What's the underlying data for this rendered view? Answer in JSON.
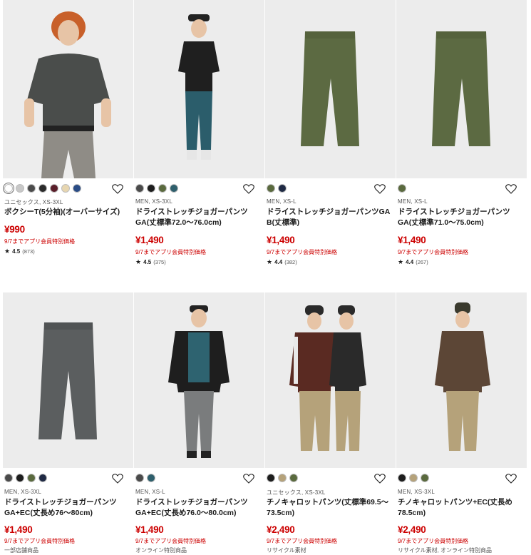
{
  "products": [
    {
      "meta": "ユニセックス, XS-3XL",
      "name": "ボクシーT(5分袖)(オーバーサイズ)",
      "price": "¥990",
      "promo": "9/7までアプリ会員特別価格",
      "rating": "4.5",
      "reviews": "(873)",
      "tag": "",
      "swatches": [
        "#ffffff",
        "#c8c8c8",
        "#4b4b4b",
        "#2a2a2a",
        "#5a1e2a",
        "#e7d6b0",
        "#2a4c86"
      ],
      "image": "model-boxy-tee"
    },
    {
      "meta": "MEN, XS-3XL",
      "name": "ドライストレッチジョガーパンツGA(丈標準72.0〜76.0cm)",
      "price": "¥1,490",
      "promo": "9/7までアプリ会員特別価格",
      "rating": "4.5",
      "reviews": "(375)",
      "tag": "",
      "swatches": [
        "#4a4a4a",
        "#1d1d1d",
        "#5a6a3e",
        "#2e5f6c"
      ],
      "image": "model-jogger-teal"
    },
    {
      "meta": "MEN, XS-L",
      "name": "ドライストレッチジョガーパンツGA B(丈標準)",
      "price": "¥1,490",
      "promo": "9/7までアプリ会員特別価格",
      "rating": "4.4",
      "reviews": "(382)",
      "tag": "",
      "swatches": [
        "#5a6a3e",
        "#1f2a44"
      ],
      "image": "olive-jogger"
    },
    {
      "meta": "MEN, XS-L",
      "name": "ドライストレッチジョガーパンツGA(丈標準71.0〜75.0cm)",
      "price": "¥1,490",
      "promo": "9/7までアプリ会員特別価格",
      "rating": "4.4",
      "reviews": "(267)",
      "tag": "",
      "swatches": [
        "#5a6a3e"
      ],
      "image": "olive-jogger-2"
    },
    {
      "meta": "MEN, XS-3XL",
      "name": "ドライストレッチジョガーパンツGA+EC(丈長め76〜80cm)",
      "price": "¥1,490",
      "promo": "9/7までアプリ会員特別価格",
      "rating": "",
      "reviews": "",
      "tag": "一部店舗商品",
      "swatches": [
        "#4a4a4a",
        "#1d1d1d",
        "#5a6a3e",
        "#1f2a44"
      ],
      "image": "gray-jogger"
    },
    {
      "meta": "MEN, XS-L",
      "name": "ドライストレッチジョガーパンツGA+EC(丈長め76.0〜80.0cm)",
      "price": "¥1,490",
      "promo": "9/7までアプリ会員特別価格",
      "rating": "",
      "reviews": "",
      "tag": "オンライン特別商品",
      "swatches": [
        "#4a4a4a",
        "#2e5f6c"
      ],
      "image": "model-jogger-gray"
    },
    {
      "meta": "ユニセックス, XS-3XL",
      "name": "チノキャロットパンツ(丈標準69.5〜73.5cm)",
      "price": "¥2,490",
      "promo": "9/7までアプリ会員特別価格",
      "rating": "",
      "reviews": "",
      "tag": "リサイクル素材",
      "swatches": [
        "#1d1d1d",
        "#b5a27a",
        "#5a6a3e"
      ],
      "image": "models-chino-pair"
    },
    {
      "meta": "MEN, XS-3XL",
      "name": "チノキャロットパンツ+EC(丈長め78.5cm)",
      "price": "¥2,490",
      "promo": "9/7までアプリ会員特別価格",
      "rating": "",
      "reviews": "",
      "tag": "リサイクル素材, オンライン特別商品",
      "swatches": [
        "#1d1d1d",
        "#b5a27a",
        "#5a6a3e"
      ],
      "image": "model-chino"
    }
  ]
}
